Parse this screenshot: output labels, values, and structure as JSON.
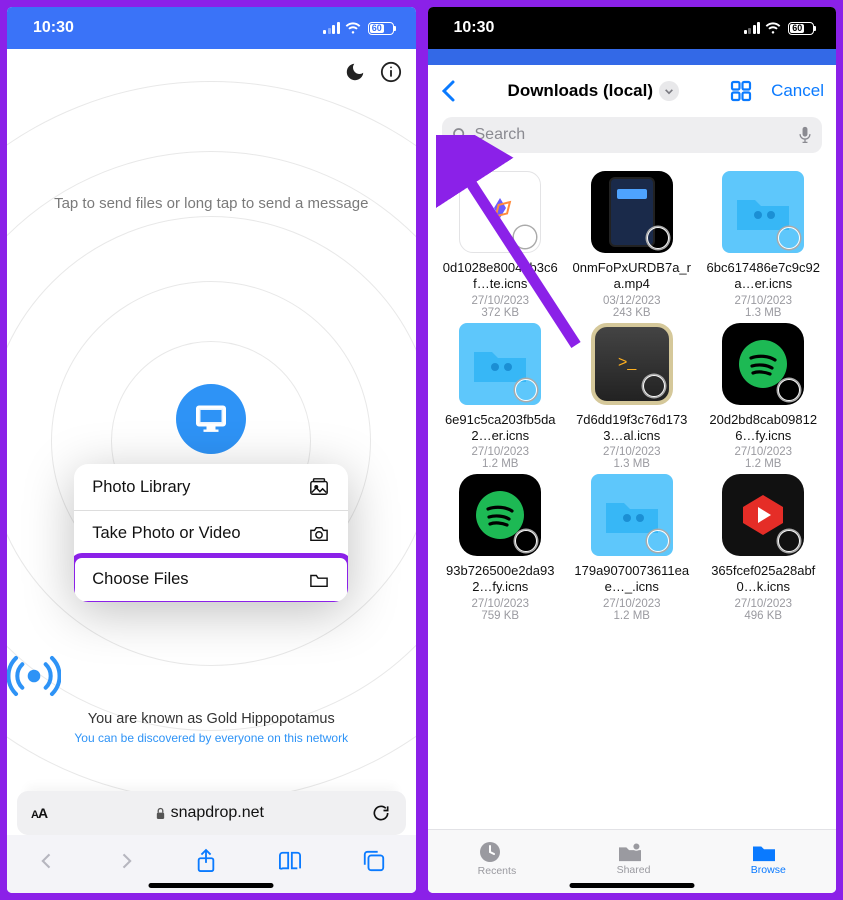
{
  "status": {
    "time": "10:30",
    "battery": "60"
  },
  "left": {
    "hint": "Tap to send files or long tap to send a message",
    "menu": {
      "photo": "Photo Library",
      "camera": "Take Photo or Video",
      "files": "Choose Files"
    },
    "known_as": "You are known as Gold Hippopotamus",
    "discover": "You can be discovered by everyone on this network",
    "addr": {
      "aa": "AA",
      "lock": "🔒",
      "domain": "snapdrop.net"
    }
  },
  "right": {
    "title": "Downloads (local)",
    "cancel": "Cancel",
    "search_placeholder": "Search",
    "tabs": {
      "recents": "Recents",
      "shared": "Shared",
      "browse": "Browse"
    },
    "files": [
      {
        "name": "0d1028e8004db3c6f…te.icns",
        "date": "27/10/2023",
        "size": "372 KB",
        "kind": "whiteapp"
      },
      {
        "name": "0nmFoPxURDB7a_ra.mp4",
        "date": "03/12/2023",
        "size": "243 KB",
        "kind": "phone-screen"
      },
      {
        "name": "6bc617486e7c9c92a…er.icns",
        "date": "27/10/2023",
        "size": "1.3 MB",
        "kind": "folder"
      },
      {
        "name": "6e91c5ca203fb5da2…er.icns",
        "date": "27/10/2023",
        "size": "1.2 MB",
        "kind": "folder"
      },
      {
        "name": "7d6dd19f3c76d1733…al.icns",
        "date": "27/10/2023",
        "size": "1.3 MB",
        "kind": "terminal"
      },
      {
        "name": "20d2bd8cab098126…fy.icns",
        "date": "27/10/2023",
        "size": "1.2 MB",
        "kind": "spotify"
      },
      {
        "name": "93b726500e2da932…fy.icns",
        "date": "27/10/2023",
        "size": "759 KB",
        "kind": "spotify"
      },
      {
        "name": "179a9070073611eae…_.icns",
        "date": "27/10/2023",
        "size": "1.2 MB",
        "kind": "folder"
      },
      {
        "name": "365fcef025a28abf0…k.icns",
        "date": "27/10/2023",
        "size": "496 KB",
        "kind": "youtube"
      }
    ]
  }
}
